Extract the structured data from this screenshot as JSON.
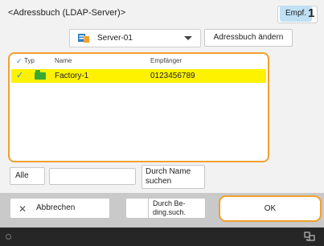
{
  "header": {
    "title": "<Adressbuch (LDAP-Server)>",
    "recipients_label": "Empf.",
    "recipients_count": "1"
  },
  "server": {
    "selected": "Server-01",
    "icon": "server-icon"
  },
  "toolbar": {
    "change_addressbook_label": "Adressbuch ändern"
  },
  "list": {
    "columns": {
      "check": "✓",
      "type": "Typ",
      "name": "Name",
      "recipient": "Empfänger"
    },
    "rows": [
      {
        "checked": true,
        "type_icon": "folder-icon",
        "name": "Factory-1",
        "recipient": "0123456789"
      }
    ]
  },
  "search": {
    "all_label": "Alle",
    "input_value": "",
    "by_name_label": "Durch Name\nsuchen"
  },
  "footer": {
    "cancel_label": "Abbrechen",
    "by_condition_label": "Durch Be-\nding.such.",
    "ok_label": "OK"
  },
  "colors": {
    "highlight_row": "#fff200",
    "focus_border": "#f0a030",
    "recipients_badge": "#bfe0f5",
    "check_mark": "#2f8ec8",
    "folder_icon": "#39a935"
  }
}
